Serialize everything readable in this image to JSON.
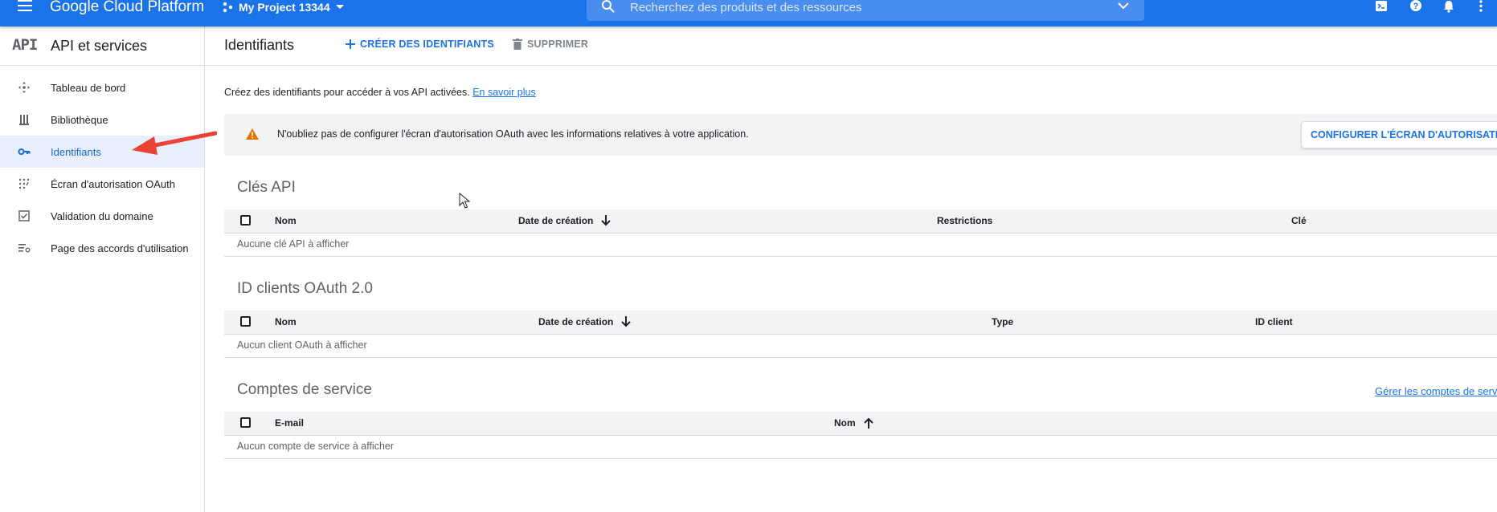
{
  "topbar": {
    "brand": "Google Cloud Platform",
    "project": "My Project 13344",
    "search_placeholder": "Recherchez des produits et des ressources",
    "icons": [
      "menu-icon",
      "project-dots-icon",
      "search-icon",
      "chevron-down-icon",
      "cloud-shell-icon",
      "help-icon",
      "notifications-icon",
      "more-vert-icon"
    ]
  },
  "sidebar": {
    "logo": "API",
    "title": "API et services",
    "items": [
      {
        "label": "Tableau de bord",
        "icon": "dashboard-icon"
      },
      {
        "label": "Bibliothèque",
        "icon": "library-icon"
      },
      {
        "label": "Identifiants",
        "icon": "key-icon",
        "active": true
      },
      {
        "label": "Écran d'autorisation OAuth",
        "icon": "oauth-consent-icon"
      },
      {
        "label": "Validation du domaine",
        "icon": "checkbox-icon"
      },
      {
        "label": "Page des accords d'utilisation",
        "icon": "list-settings-icon"
      }
    ]
  },
  "header": {
    "title": "Identifiants",
    "create_label": "CRÉER DES IDENTIFIANTS",
    "delete_label": "SUPPRIMER"
  },
  "intro": {
    "text": "Créez des identifiants pour accéder à vos API activées.",
    "link": "En savoir plus"
  },
  "banner": {
    "message": "N'oubliez pas de configurer l'écran d'autorisation OAuth avec les informations relatives à votre application.",
    "button": "CONFIGURER L'ÉCRAN D'AUTORISATION"
  },
  "api_keys": {
    "title": "Clés API",
    "columns": [
      "Nom",
      "Date de création",
      "Restrictions",
      "Clé"
    ],
    "empty": "Aucune clé API à afficher"
  },
  "oauth_clients": {
    "title": "ID clients OAuth 2.0",
    "columns": [
      "Nom",
      "Date de création",
      "Type",
      "ID client"
    ],
    "empty": "Aucun client OAuth à afficher"
  },
  "service_accounts": {
    "title": "Comptes de service",
    "manage_link": "Gérer les comptes de service",
    "columns": [
      "E-mail",
      "Nom"
    ],
    "empty": "Aucun compte de service à afficher"
  },
  "colors": {
    "brand_blue": "#1a73e8",
    "active_bg": "#e8f0fe",
    "warning": "#e37400",
    "annotation_arrow": "#ea4335"
  }
}
